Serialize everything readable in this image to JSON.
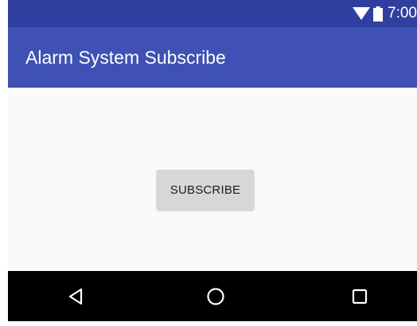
{
  "status_bar": {
    "time": "7:00",
    "icons": [
      "wifi-icon",
      "battery-icon"
    ],
    "color": "#303f9f"
  },
  "app_bar": {
    "title": "Alarm System Subscribe",
    "color": "#3f51b5"
  },
  "main": {
    "subscribe_label": "SUBSCRIBE"
  },
  "nav_bar": {
    "buttons": [
      "back-icon",
      "home-icon",
      "recents-icon"
    ],
    "color": "#000000"
  }
}
